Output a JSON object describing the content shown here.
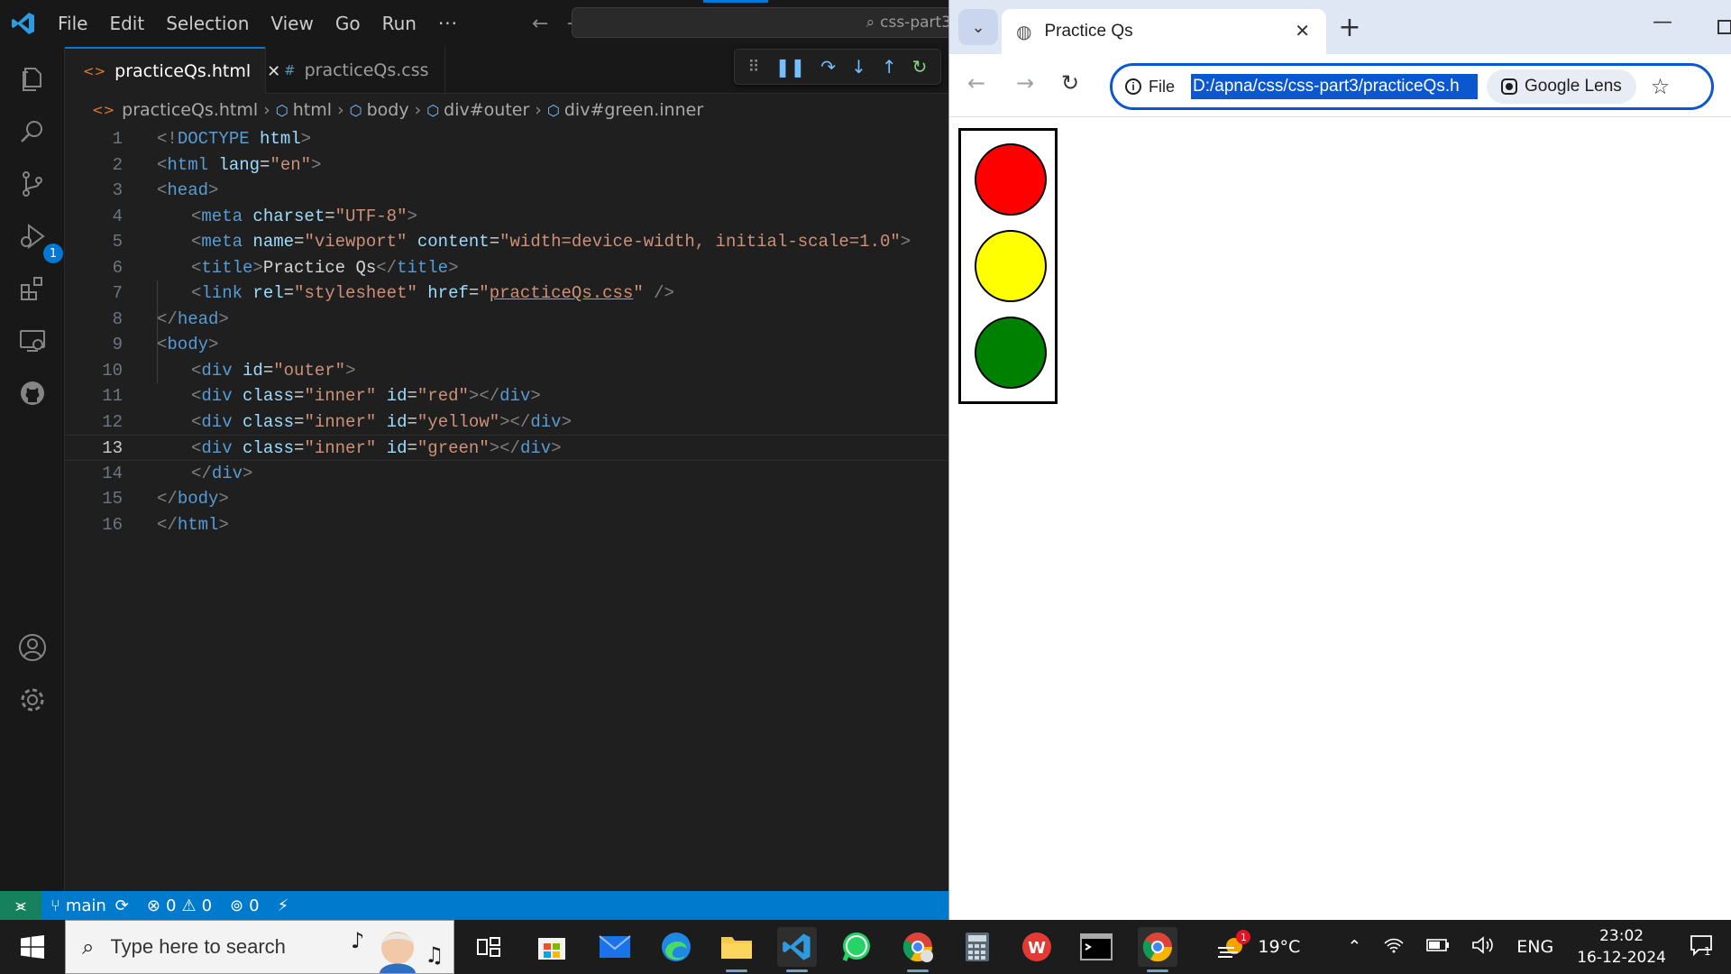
{
  "vscode": {
    "menu": [
      "File",
      "Edit",
      "Selection",
      "View",
      "Go",
      "Run",
      "···"
    ],
    "command_center": "css-part3",
    "tabs": [
      {
        "label": "practiceQs.html",
        "icon": "html-file-icon",
        "active": true
      },
      {
        "label": "practiceQs.css",
        "icon": "hash-icon",
        "active": false
      }
    ],
    "breadcrumbs": [
      "practiceQs.html",
      "html",
      "body",
      "div#outer",
      "div#green.inner"
    ],
    "debug_badge": "1",
    "current_line": 13,
    "code": [
      {
        "n": "1",
        "indent": 0,
        "tokens": [
          [
            "tg",
            "<!"
          ],
          [
            "tn",
            "DOCTYPE"
          ],
          [
            "tx",
            " "
          ],
          [
            "at",
            "html"
          ],
          [
            "tg",
            ">"
          ]
        ]
      },
      {
        "n": "2",
        "indent": 0,
        "tokens": [
          [
            "tg",
            "<"
          ],
          [
            "tn",
            "html"
          ],
          [
            "tx",
            " "
          ],
          [
            "at",
            "lang"
          ],
          [
            "tx",
            "="
          ],
          [
            "st",
            "\"en\""
          ],
          [
            "tg",
            ">"
          ]
        ]
      },
      {
        "n": "3",
        "indent": 0,
        "tokens": [
          [
            "tg",
            "<"
          ],
          [
            "tn",
            "head"
          ],
          [
            "tg",
            ">"
          ]
        ]
      },
      {
        "n": "4",
        "indent": 1,
        "tokens": [
          [
            "tg",
            "<"
          ],
          [
            "tn",
            "meta"
          ],
          [
            "tx",
            " "
          ],
          [
            "at",
            "charset"
          ],
          [
            "tx",
            "="
          ],
          [
            "st",
            "\"UTF-8\""
          ],
          [
            "tg",
            ">"
          ]
        ]
      },
      {
        "n": "5",
        "indent": 1,
        "tokens": [
          [
            "tg",
            "<"
          ],
          [
            "tn",
            "meta"
          ],
          [
            "tx",
            " "
          ],
          [
            "at",
            "name"
          ],
          [
            "tx",
            "="
          ],
          [
            "st",
            "\"viewport\""
          ],
          [
            "tx",
            " "
          ],
          [
            "at",
            "content"
          ],
          [
            "tx",
            "="
          ],
          [
            "st",
            "\"width=device-width, initial-scale=1.0\""
          ],
          [
            "tg",
            ">"
          ]
        ]
      },
      {
        "n": "6",
        "indent": 1,
        "tokens": [
          [
            "tg",
            "<"
          ],
          [
            "tn",
            "title"
          ],
          [
            "tg",
            ">"
          ],
          [
            "tx",
            "Practice Qs"
          ],
          [
            "tg",
            "</"
          ],
          [
            "tn",
            "title"
          ],
          [
            "tg",
            ">"
          ]
        ]
      },
      {
        "n": "7",
        "indent": 1,
        "tokens": [
          [
            "tg",
            "<"
          ],
          [
            "tn",
            "link"
          ],
          [
            "tx",
            " "
          ],
          [
            "at",
            "rel"
          ],
          [
            "tx",
            "="
          ],
          [
            "st",
            "\"stylesheet\""
          ],
          [
            "tx",
            " "
          ],
          [
            "at",
            "href"
          ],
          [
            "tx",
            "="
          ],
          [
            "st",
            "\""
          ],
          [
            "stu",
            "practiceQs.css"
          ],
          [
            "st",
            "\""
          ],
          [
            "tx",
            " "
          ],
          [
            "tg",
            "/>"
          ]
        ]
      },
      {
        "n": "8",
        "indent": 0,
        "tokens": [
          [
            "tg",
            "</"
          ],
          [
            "tn",
            "head"
          ],
          [
            "tg",
            ">"
          ]
        ]
      },
      {
        "n": "9",
        "indent": 0,
        "tokens": [
          [
            "tg",
            "<"
          ],
          [
            "tn",
            "body"
          ],
          [
            "tg",
            ">"
          ]
        ]
      },
      {
        "n": "10",
        "indent": 1,
        "tokens": [
          [
            "tg",
            "<"
          ],
          [
            "tn",
            "div"
          ],
          [
            "tx",
            " "
          ],
          [
            "at",
            "id"
          ],
          [
            "tx",
            "="
          ],
          [
            "st",
            "\"outer\""
          ],
          [
            "tg",
            ">"
          ]
        ]
      },
      {
        "n": "11",
        "indent": 1,
        "tokens": [
          [
            "tg",
            "<"
          ],
          [
            "tn",
            "div"
          ],
          [
            "tx",
            " "
          ],
          [
            "at",
            "class"
          ],
          [
            "tx",
            "="
          ],
          [
            "st",
            "\"inner\""
          ],
          [
            "tx",
            " "
          ],
          [
            "at",
            "id"
          ],
          [
            "tx",
            "="
          ],
          [
            "st",
            "\"red\""
          ],
          [
            "tg",
            "></"
          ],
          [
            "tn",
            "div"
          ],
          [
            "tg",
            ">"
          ]
        ]
      },
      {
        "n": "12",
        "indent": 1,
        "tokens": [
          [
            "tg",
            "<"
          ],
          [
            "tn",
            "div"
          ],
          [
            "tx",
            " "
          ],
          [
            "at",
            "class"
          ],
          [
            "tx",
            "="
          ],
          [
            "st",
            "\"inner\""
          ],
          [
            "tx",
            " "
          ],
          [
            "at",
            "id"
          ],
          [
            "tx",
            "="
          ],
          [
            "st",
            "\"yellow\""
          ],
          [
            "tg",
            "></"
          ],
          [
            "tn",
            "div"
          ],
          [
            "tg",
            ">"
          ]
        ]
      },
      {
        "n": "13",
        "indent": 1,
        "tokens": [
          [
            "tg",
            "<"
          ],
          [
            "tn",
            "div"
          ],
          [
            "tx",
            " "
          ],
          [
            "at",
            "class"
          ],
          [
            "tx",
            "="
          ],
          [
            "st",
            "\"inner\""
          ],
          [
            "tx",
            " "
          ],
          [
            "at",
            "id"
          ],
          [
            "tx",
            "="
          ],
          [
            "st",
            "\"green\""
          ],
          [
            "tg",
            "></"
          ],
          [
            "tn",
            "div"
          ],
          [
            "tg",
            ">"
          ]
        ]
      },
      {
        "n": "14",
        "indent": 1,
        "tokens": [
          [
            "tg",
            "</"
          ],
          [
            "tn",
            "div"
          ],
          [
            "tg",
            ">"
          ]
        ]
      },
      {
        "n": "15",
        "indent": 0,
        "tokens": [
          [
            "tg",
            "</"
          ],
          [
            "tn",
            "body"
          ],
          [
            "tg",
            ">"
          ]
        ]
      },
      {
        "n": "16",
        "indent": 0,
        "tokens": [
          [
            "tg",
            "</"
          ],
          [
            "tn",
            "html"
          ],
          [
            "tg",
            ">"
          ]
        ]
      }
    ],
    "status": {
      "branch": "main",
      "errors": "0",
      "warnings": "0",
      "ports": "0"
    },
    "colors": {
      "accent": "#007acc",
      "editor_bg": "#1f1f1f"
    }
  },
  "chrome": {
    "tab_title": "Practice Qs",
    "omnibox": {
      "chip": "File",
      "url": "D:/apna/css/css-part3/practiceQs.h",
      "lens": "Google Lens"
    },
    "lights": [
      {
        "name": "red-light",
        "color": "#ff0000"
      },
      {
        "name": "yellow-light",
        "color": "#ffff00"
      },
      {
        "name": "green-light",
        "color": "#008000"
      }
    ]
  },
  "taskbar": {
    "search_placeholder": "Type here to search",
    "weather": "19°C",
    "weather_badge": "1",
    "language": "ENG",
    "time": "23:02",
    "date": "16-12-2024",
    "notification_count": "1",
    "apps": [
      "task-view-icon",
      "microsoft-store-icon",
      "mail-icon",
      "edge-icon",
      "file-explorer-icon",
      "vscode-icon",
      "whatsapp-icon",
      "chrome-profile-icon",
      "calculator-icon",
      "wps-office-icon",
      "terminal-icon",
      "chrome-icon"
    ]
  }
}
